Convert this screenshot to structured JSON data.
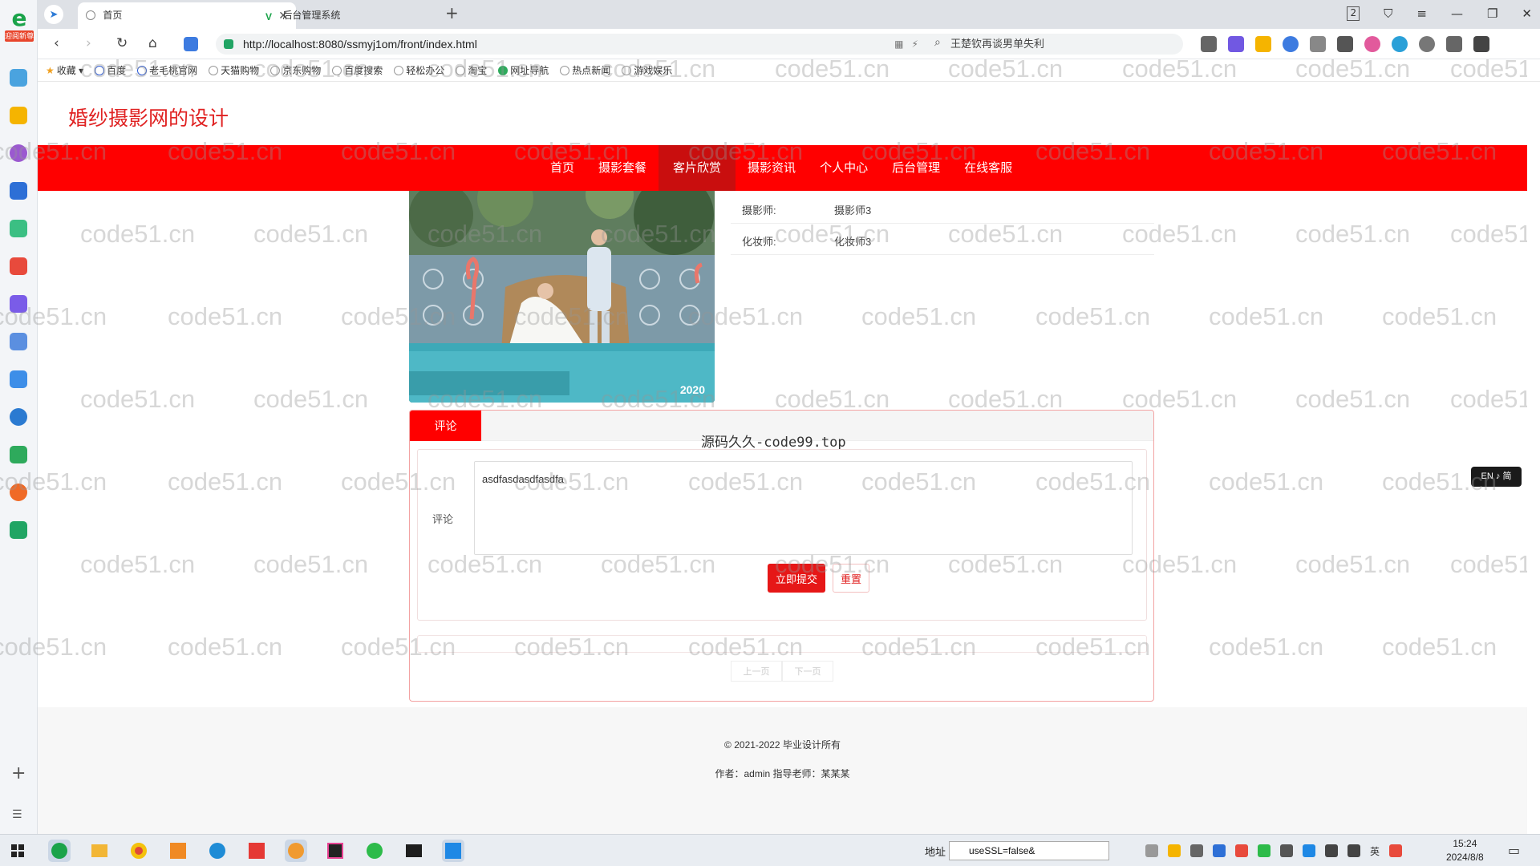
{
  "browser": {
    "sidebar_badge": "迎阅新尊",
    "tabs": [
      {
        "label": "首页",
        "active": true
      },
      {
        "label": "后台管理系统",
        "active": false
      }
    ],
    "url": "http://localhost:8080/ssmyj1om/front/index.html",
    "search_text": "王楚钦再谈男单失利",
    "bookmarks": [
      "收藏",
      "百度",
      "老毛桃官网",
      "天猫购物",
      "京东购物",
      "百度搜索",
      "轻松办公",
      "淘宝",
      "网址导航",
      "热点新闻",
      "游戏娱乐"
    ],
    "colors": {
      "tab_bar": "#dee1e6",
      "secure": "#21a464"
    }
  },
  "site": {
    "title": "婚纱摄影网的设计",
    "nav": [
      {
        "label": "首页",
        "active": false
      },
      {
        "label": "摄影套餐",
        "active": false
      },
      {
        "label": "客片欣赏",
        "active": true
      },
      {
        "label": "摄影资讯",
        "active": false
      },
      {
        "label": "个人中心",
        "active": false
      },
      {
        "label": "后台管理",
        "active": false
      },
      {
        "label": "在线客服",
        "active": false
      }
    ],
    "accent_color": "#ff0000"
  },
  "detail": {
    "photo_caption": "2020",
    "rows": [
      {
        "key": "摄影师:",
        "value": "摄影师3"
      },
      {
        "key": "化妆师:",
        "value": "化妆师3"
      }
    ]
  },
  "comment": {
    "tab_label": "评论",
    "overlay_title": "源码久久-code99.top",
    "field_label": "评论",
    "textarea_value": "asdfasdasdfasdfa",
    "submit_label": "立即提交",
    "reset_label": "重置",
    "pager": {
      "prev": "上一页",
      "next": "下一页"
    }
  },
  "footer": {
    "copyright": "© 2021-2022 毕业设计所有",
    "author": "作者：admin 指导老师：某某某"
  },
  "lang_switch": "EN ♪ 简",
  "watermark_text": "code51.cn",
  "taskbar": {
    "addr_label": "地址",
    "addr_value": "useSSL=false&",
    "time": "15:24",
    "date": "2024/8/8",
    "ime": "英"
  }
}
